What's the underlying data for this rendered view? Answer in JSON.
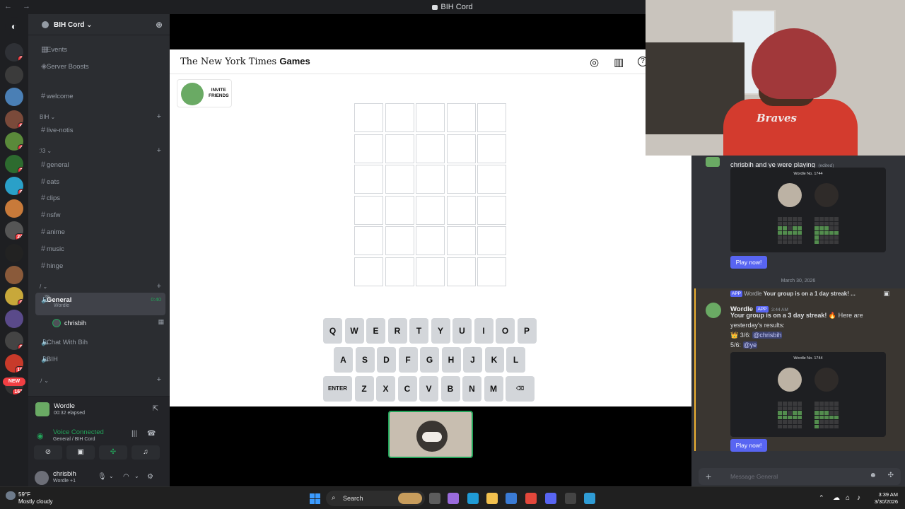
{
  "window": {
    "title": "BIH Cord",
    "nav": "← →"
  },
  "guilds": {
    "items": [
      {
        "name": "home",
        "color": "#1e1f22",
        "badge": ""
      },
      {
        "name": "server-bih",
        "color": "#2f3136",
        "badge": "2"
      },
      {
        "name": "server-2",
        "color": "#3b3b3b",
        "badge": ""
      },
      {
        "name": "server-3",
        "color": "#4a7fb5",
        "badge": ""
      },
      {
        "name": "server-4",
        "color": "#7a4a3a",
        "badge": "6"
      },
      {
        "name": "server-5",
        "color": "#5a8a3a",
        "badge": "4"
      },
      {
        "name": "server-havin",
        "color": "#2d6b2f",
        "badge": "3"
      },
      {
        "name": "server-7",
        "color": "#2aa0c8",
        "badge": "6"
      },
      {
        "name": "server-8",
        "color": "#c87a3a",
        "badge": ""
      },
      {
        "name": "server-9",
        "color": "#555555",
        "badge": "24"
      },
      {
        "name": "server-10",
        "color": "#222222",
        "badge": ""
      },
      {
        "name": "server-11",
        "color": "#8a5a3a",
        "badge": ""
      },
      {
        "name": "server-12",
        "color": "#c8a83a",
        "badge": "9"
      },
      {
        "name": "server-13",
        "color": "#5a4a8a",
        "badge": ""
      },
      {
        "name": "server-14",
        "color": "#444444",
        "badge": "5"
      },
      {
        "name": "server-15",
        "color": "#c83a2a",
        "badge": "18"
      },
      {
        "name": "server-16",
        "color": "#333333",
        "badge": "161"
      }
    ],
    "new_label": "NEW"
  },
  "server": {
    "name": "BIH Cord ⌄",
    "top_items": [
      {
        "icon": "▦",
        "label": "Events"
      },
      {
        "icon": "◈",
        "label": "Server Boosts"
      },
      {
        "icon": "#",
        "label": "welcome"
      }
    ],
    "categories": [
      {
        "label": "BIH ⌄",
        "plus": "+"
      },
      {
        "label": "ℐ3 ⌄",
        "plus": "+"
      },
      {
        "label": "/ ⌄",
        "plus": "+"
      },
      {
        "label": "ﾉ ⌄",
        "plus": "+"
      }
    ],
    "channels": {
      "bih": [
        {
          "icon": "#",
          "label": "live-notis"
        }
      ],
      "main": [
        {
          "icon": "#",
          "label": "general"
        },
        {
          "icon": "#",
          "label": "eats"
        },
        {
          "icon": "#",
          "label": "clips"
        },
        {
          "icon": "#",
          "label": "nsfw"
        },
        {
          "icon": "#",
          "label": "anime"
        },
        {
          "icon": "#",
          "label": "music"
        },
        {
          "icon": "#",
          "label": "hinge"
        }
      ],
      "voice_active": {
        "label": "General",
        "sub": "Wordle",
        "timer": "0:40"
      },
      "voice_user": "chrisbih",
      "voice_others": [
        {
          "icon": "🔈",
          "label": "Chat With Bih"
        },
        {
          "icon": "🔈",
          "label": "BIH"
        }
      ]
    }
  },
  "activity": {
    "title": "Wordle",
    "sub": "00:32 elapsed",
    "icon": "⇱"
  },
  "voice": {
    "status": "Voice Connected",
    "sub": "General / BIH Cord",
    "signal_icon": "◉",
    "noise_icon": "|||",
    "disconnect_icon": "☎",
    "buttons": [
      {
        "name": "camera-off-button",
        "icon": "⊘"
      },
      {
        "name": "screen-share-button",
        "icon": "▣"
      },
      {
        "name": "activity-button",
        "icon": "✣"
      },
      {
        "name": "soundboard-button",
        "icon": "♫"
      }
    ]
  },
  "user": {
    "name": "chrisbih",
    "status": "Wordle +1",
    "icons": [
      {
        "name": "mic-icon",
        "glyph": "🎙"
      },
      {
        "name": "mic-options-icon",
        "glyph": "⌄"
      },
      {
        "name": "headphones-icon",
        "glyph": "◠"
      },
      {
        "name": "headphones-options-icon",
        "glyph": "⌄"
      },
      {
        "name": "settings-icon",
        "glyph": "⚙"
      }
    ]
  },
  "game": {
    "logo_serif": "The New York Times",
    "logo_bold": "Games",
    "header_icons": [
      {
        "name": "hint-icon",
        "glyph": "◎"
      },
      {
        "name": "stats-icon",
        "glyph": "▥"
      },
      {
        "name": "help-icon",
        "glyph": "?"
      }
    ],
    "invite_label_1": "INVITE",
    "invite_label_2": "FRIENDS",
    "rows": 6,
    "cols": 5,
    "keyboard": [
      [
        "Q",
        "W",
        "E",
        "R",
        "T",
        "Y",
        "U",
        "I",
        "O",
        "P"
      ],
      [
        "A",
        "S",
        "D",
        "F",
        "G",
        "H",
        "J",
        "K",
        "L"
      ],
      [
        "ENTER",
        "Z",
        "X",
        "C",
        "V",
        "B",
        "N",
        "M",
        "⌫"
      ]
    ]
  },
  "chat": {
    "first": {
      "author": "chrisbih and ye were playing",
      "edited": "(edited)",
      "embed_title": "Wordle No. 1744",
      "play": "Play now!"
    },
    "date": "March 30, 2026",
    "reply": {
      "app": "APP",
      "author": "Wordle",
      "text": "Your group is on a 1 day streak! ..."
    },
    "second": {
      "author": "Wordle",
      "app": "APP",
      "time": "3:44 AM",
      "line1_bold": "Your group is on a 3 day streak! 🔥",
      "line1_rest": " Here are",
      "line2": "yesterday's results:",
      "line3_prefix": "👑 3/6: ",
      "line3_mention": "@chrisbih",
      "line4_prefix": "5/6: ",
      "line4_mention": "@ye",
      "embed_title": "Wordle No. 1744",
      "play": "Play now!"
    },
    "input_placeholder": "Message General",
    "input_plus": "+",
    "input_icons": [
      {
        "name": "emoji-icon",
        "glyph": "☻"
      },
      {
        "name": "apps-icon",
        "glyph": "✣"
      }
    ]
  },
  "webcam": {
    "shirt_text": "Braves"
  },
  "taskbar": {
    "temp": "59°F",
    "weather": "Mostly cloudy",
    "search_icon": "⌕",
    "search_label": "Search",
    "tray_chevron": "⌃",
    "time": "3:39 AM",
    "date": "3/30/2026",
    "apps": [
      {
        "name": "task-view-icon",
        "color": "#5d5d5d"
      },
      {
        "name": "copilot-icon",
        "color": "#9a6bdc"
      },
      {
        "name": "edge-icon",
        "color": "#1f9bd6"
      },
      {
        "name": "file-explorer-icon",
        "color": "#f2c14e"
      },
      {
        "name": "store-icon",
        "color": "#3a7bd5"
      },
      {
        "name": "chrome-icon",
        "color": "#e3473b"
      },
      {
        "name": "discord-taskbar-icon",
        "color": "#5865f2"
      },
      {
        "name": "obs-icon",
        "color": "#444444"
      },
      {
        "name": "notepad-icon",
        "color": "#2f9cd5"
      }
    ],
    "tray_icons": [
      {
        "name": "onedrive-icon",
        "glyph": "☁"
      },
      {
        "name": "network-icon",
        "glyph": "⌂"
      },
      {
        "name": "volume-icon",
        "glyph": "♪"
      }
    ]
  },
  "colors": {
    "discord_bg": "#313338",
    "sidebar_bg": "#2b2d31",
    "green": "#23a55a",
    "blurple": "#5865f2",
    "wordle_green": "#6aaa64"
  }
}
